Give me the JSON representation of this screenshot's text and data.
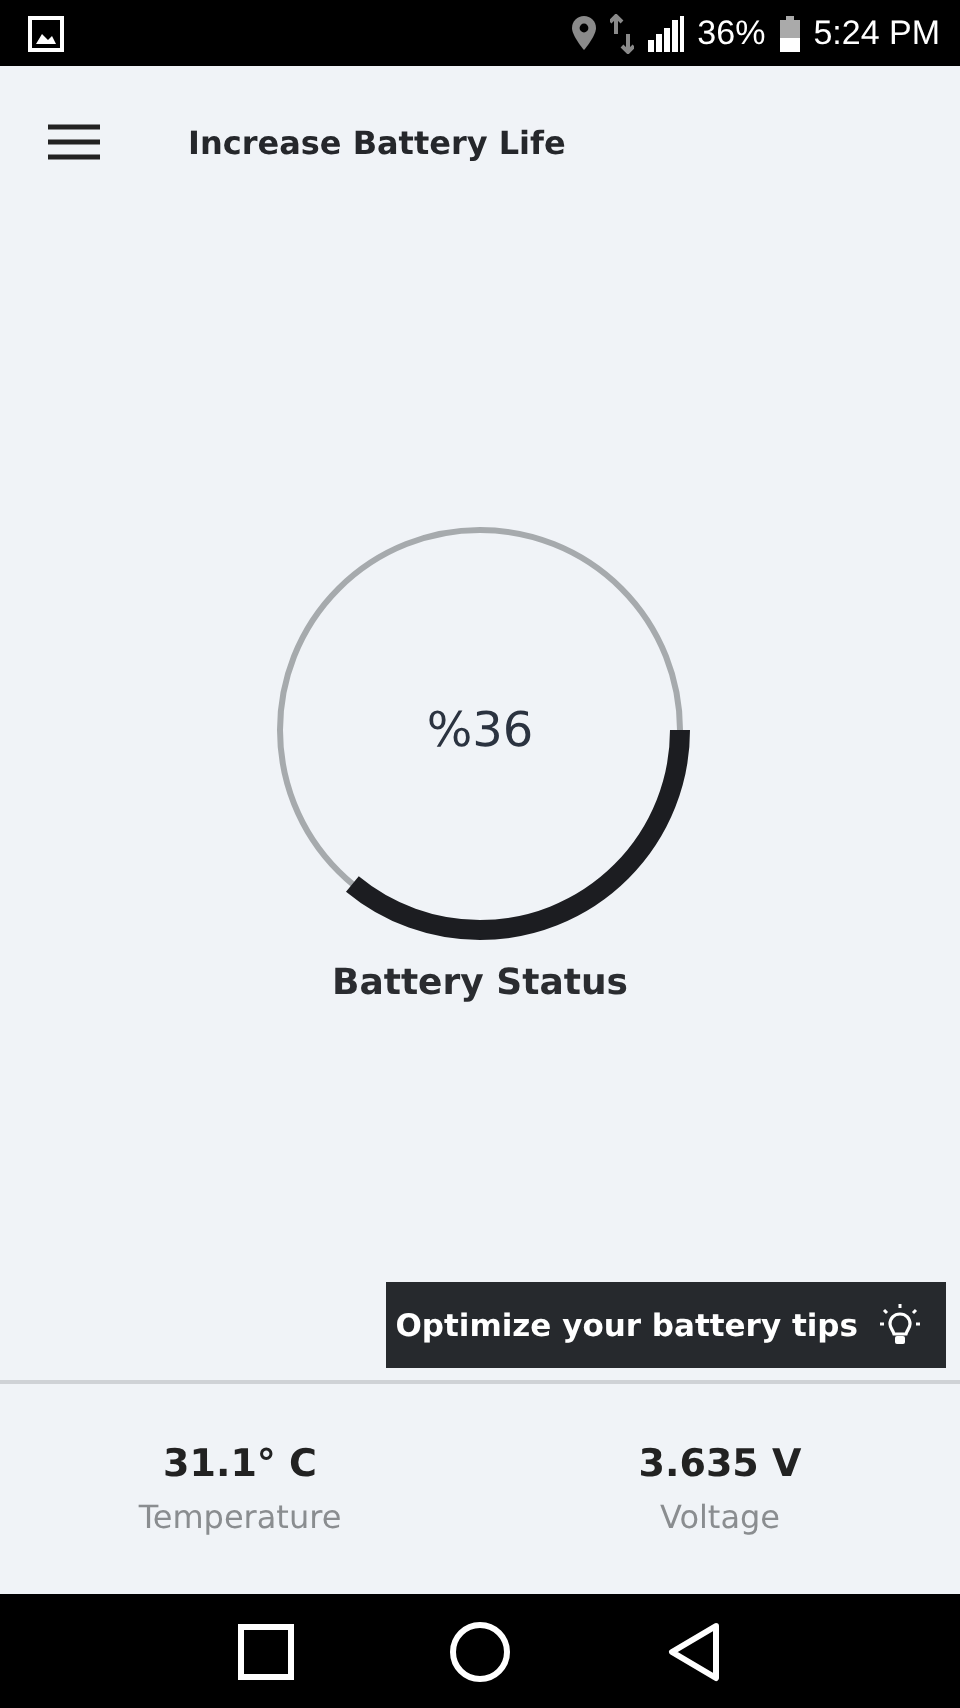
{
  "status_bar": {
    "battery_percent": "36%",
    "time": "5:24 PM"
  },
  "app_bar": {
    "title": "Increase Battery Life"
  },
  "battery": {
    "reading": "%36",
    "level": 0.36,
    "label": "Battery Status"
  },
  "tips_button": {
    "label": "Optimize your battery tips"
  },
  "stats": [
    {
      "value": "31.1° C",
      "label": "Temperature"
    },
    {
      "value": "3.635 V",
      "label": "Voltage"
    }
  ]
}
